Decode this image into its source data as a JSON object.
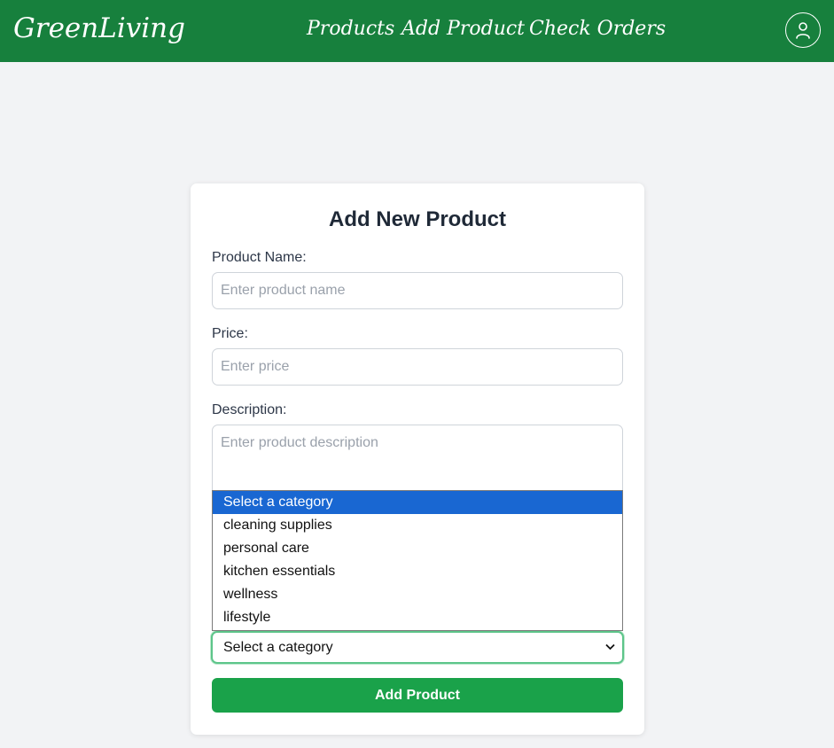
{
  "navbar": {
    "brand": "GreenLiving",
    "links": [
      "Products",
      "Add Product",
      "Check Orders"
    ],
    "account_icon": "user-icon"
  },
  "form": {
    "title": "Add New Product",
    "name_label": "Product Name:",
    "name_placeholder": "Enter product name",
    "price_label": "Price:",
    "price_placeholder": "Enter price",
    "description_label": "Description:",
    "description_placeholder": "Enter product description",
    "category": {
      "selected": "Select a category",
      "options": [
        "Select a category",
        "cleaning supplies",
        "personal care",
        "kitchen essentials",
        "wellness",
        "lifestyle"
      ],
      "highlighted_index": 0
    },
    "submit_label": "Add Product"
  },
  "colors": {
    "nav_green": "#17803d",
    "button_green": "#1aa24a",
    "highlight_blue": "#1967d2",
    "background": "#f2f3f5"
  }
}
